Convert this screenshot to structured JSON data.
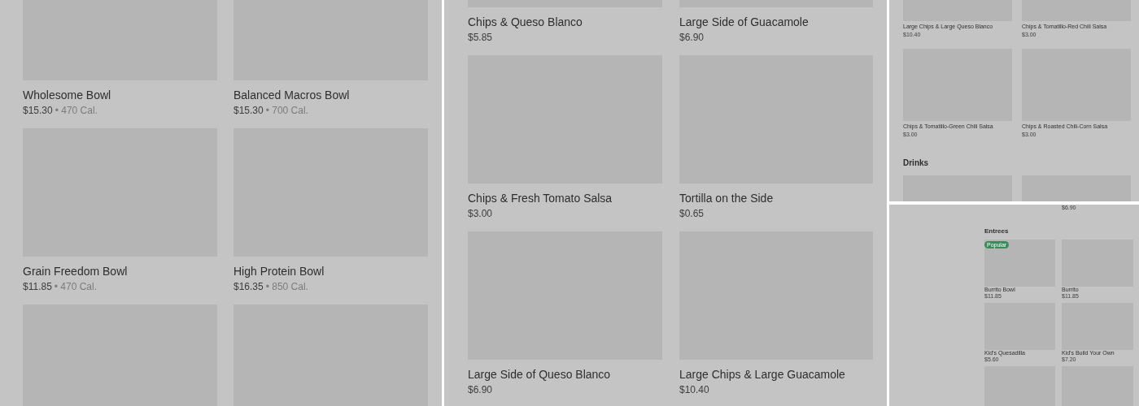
{
  "panels": [
    {
      "sections": [
        {
          "items": [
            {
              "kind": "full",
              "name": "Wholesome Bowl",
              "price": "$15.30",
              "calories": "• 470 Cal."
            },
            {
              "kind": "full",
              "name": "Balanced Macros Bowl",
              "price": "$15.30",
              "calories": "• 700 Cal."
            },
            {
              "kind": "full",
              "name": "Grain Freedom Bowl",
              "price": "$11.85",
              "calories": "• 470 Cal."
            },
            {
              "kind": "full",
              "name": "High Protein Bowl",
              "price": "$16.35",
              "calories": "• 850 Cal."
            },
            {
              "kind": "image"
            },
            {
              "kind": "image"
            }
          ]
        }
      ]
    },
    {
      "sections": [
        {
          "items": [
            {
              "kind": "full",
              "name": "Chips & Queso Blanco",
              "price": "$5.85"
            },
            {
              "kind": "full",
              "name": "Large Side of Guacamole",
              "price": "$6.90"
            },
            {
              "kind": "full",
              "name": "Chips & Fresh Tomato Salsa",
              "price": "$3.00"
            },
            {
              "kind": "full",
              "name": "Tortilla on the Side",
              "price": "$0.65"
            },
            {
              "kind": "full",
              "name": "Large Side of Queso Blanco",
              "price": "$6.90"
            },
            {
              "kind": "full",
              "name": "Large Chips & Large Guacamole",
              "price": "$10.40"
            }
          ]
        }
      ]
    },
    {
      "sections": [
        {
          "items": [
            {
              "kind": "full",
              "name": "Large Chips & Large Queso Blanco",
              "price": "$10.40"
            },
            {
              "kind": "full",
              "name": "Chips & Tomatillo-Red Chili Salsa",
              "price": "$3.00"
            },
            {
              "kind": "full",
              "name": "Chips & Tomatillo-Green Chili Salsa",
              "price": "$3.00"
            },
            {
              "kind": "full",
              "name": "Chips & Roasted Chili-Corn Salsa",
              "price": "$3.00"
            }
          ]
        },
        {
          "heading": "Drinks",
          "items": [
            {
              "kind": "image"
            },
            {
              "kind": "image"
            }
          ]
        }
      ]
    },
    {
      "sections": [
        {
          "items": [
            {
              "kind": "price",
              "price": "$6.90"
            }
          ]
        },
        {
          "heading": "Entrees",
          "items": [
            {
              "kind": "full",
              "name": "Burrito Bowl",
              "price": "$11.85",
              "badge": "Popular"
            },
            {
              "kind": "full",
              "name": "Burrito",
              "price": "$11.85"
            },
            {
              "kind": "full",
              "name": "Kid's Quesadilla",
              "price": "$5.60"
            },
            {
              "kind": "full",
              "name": "Kid's Build Your Own",
              "price": "$7.20"
            },
            {
              "kind": "image"
            },
            {
              "kind": "image"
            }
          ]
        }
      ]
    }
  ]
}
